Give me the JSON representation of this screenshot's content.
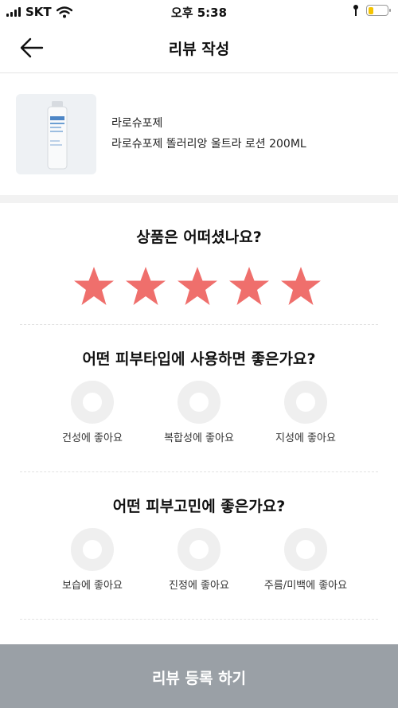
{
  "status_bar": {
    "carrier": "SKT",
    "time": "오후 5:38",
    "icons": [
      "signal-icon",
      "wifi-icon",
      "location-icon",
      "battery-icon"
    ],
    "battery_level": 0.28,
    "battery_color": "#f5c400"
  },
  "header": {
    "title": "리뷰 작성",
    "back_icon": "arrow-left-icon"
  },
  "product": {
    "brand": "라로슈포제",
    "name": "라로슈포제 똘러리앙 울트라 로션 200ML"
  },
  "rating": {
    "question": "상품은 어떠셨나요?",
    "stars_selected": 5,
    "stars_total": 5,
    "star_color": "#ef6f6c"
  },
  "skin_type": {
    "question": "어떤 피부타입에 사용하면 좋은가요?",
    "options": [
      {
        "label": "건성에 좋아요"
      },
      {
        "label": "복합성에 좋아요"
      },
      {
        "label": "지성에 좋아요"
      }
    ]
  },
  "skin_concern": {
    "question": "어떤 피부고민에 좋은가요?",
    "options": [
      {
        "label": "보습에 좋아요"
      },
      {
        "label": "진정에 좋아요"
      },
      {
        "label": "주름/미백에 좋아요"
      }
    ]
  },
  "submit": {
    "label": "리뷰 등록 하기",
    "color": "#9aa0a6"
  }
}
